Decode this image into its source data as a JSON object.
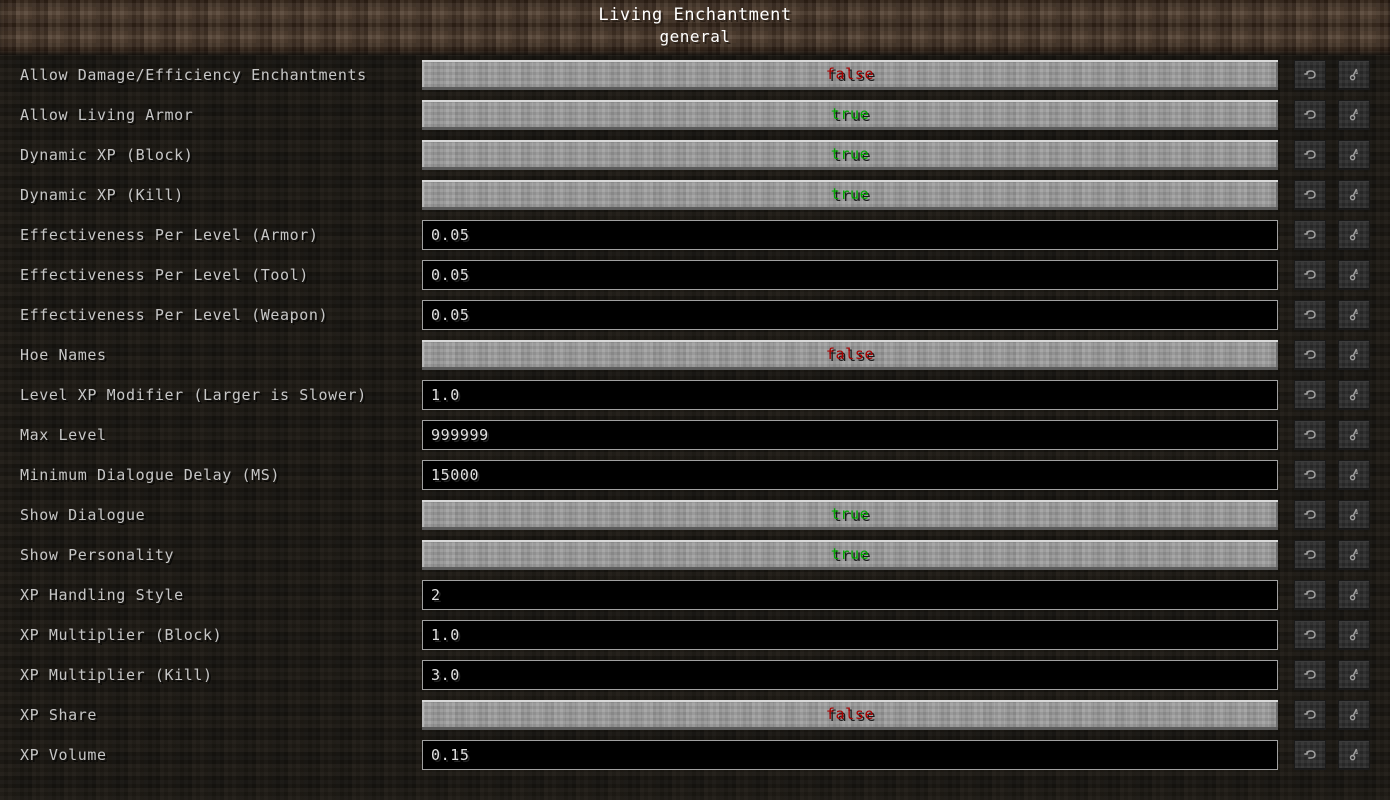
{
  "header": {
    "title": "Living Enchantment",
    "category": "general"
  },
  "colors": {
    "true": "#00aa00",
    "false": "#aa0000",
    "label": "#c6c6c6",
    "header_bg": "#4a3626",
    "body_bg": "#15130f",
    "button_face": "#9a9a9a",
    "field_bg": "#000000",
    "field_border": "#a0a0a0"
  },
  "icons": {
    "reset": "undo-arrow-icon",
    "key": "key-icon"
  },
  "buttons": {
    "reset_tooltip": "Reset",
    "key_tooltip": "Key"
  },
  "entries": [
    {
      "label": "Allow Damage/Efficiency Enchantments",
      "type": "toggle",
      "value": "false"
    },
    {
      "label": "Allow Living Armor",
      "type": "toggle",
      "value": "true"
    },
    {
      "label": "Dynamic XP (Block)",
      "type": "toggle",
      "value": "true"
    },
    {
      "label": "Dynamic XP (Kill)",
      "type": "toggle",
      "value": "true"
    },
    {
      "label": "Effectiveness Per Level (Armor)",
      "type": "text",
      "value": "0.05"
    },
    {
      "label": "Effectiveness Per Level (Tool)",
      "type": "text",
      "value": "0.05"
    },
    {
      "label": "Effectiveness Per Level (Weapon)",
      "type": "text",
      "value": "0.05"
    },
    {
      "label": "Hoe Names",
      "type": "toggle",
      "value": "false"
    },
    {
      "label": "Level XP Modifier (Larger is Slower)",
      "type": "text",
      "value": "1.0"
    },
    {
      "label": "Max Level",
      "type": "text",
      "value": "999999"
    },
    {
      "label": "Minimum Dialogue Delay (MS)",
      "type": "text",
      "value": "15000"
    },
    {
      "label": "Show Dialogue",
      "type": "toggle",
      "value": "true"
    },
    {
      "label": "Show Personality",
      "type": "toggle",
      "value": "true"
    },
    {
      "label": "XP Handling Style",
      "type": "text",
      "value": "2"
    },
    {
      "label": "XP Multiplier (Block)",
      "type": "text",
      "value": "1.0"
    },
    {
      "label": "XP Multiplier (Kill)",
      "type": "text",
      "value": "3.0"
    },
    {
      "label": "XP Share",
      "type": "toggle",
      "value": "false"
    },
    {
      "label": "XP Volume",
      "type": "text",
      "value": "0.15"
    }
  ]
}
